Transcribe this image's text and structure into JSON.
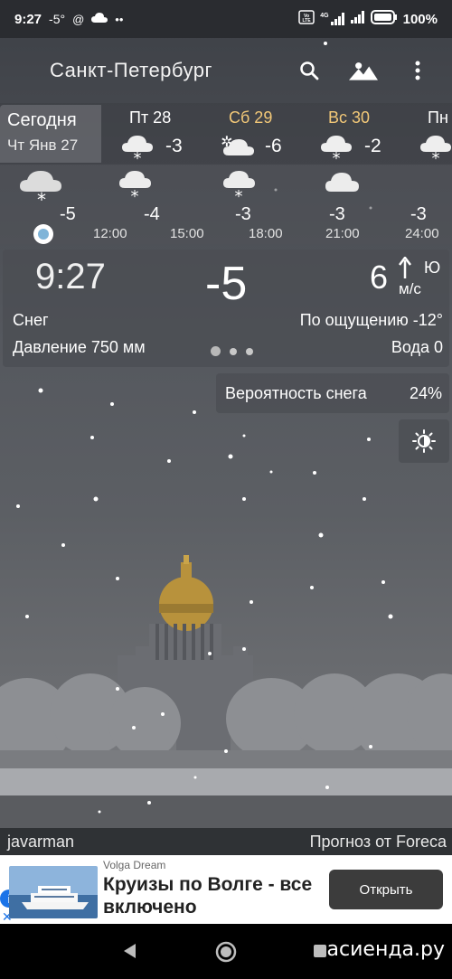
{
  "status_bar": {
    "time": "9:27",
    "temp": "-5°",
    "battery": "100%",
    "network": "4G"
  },
  "toolbar": {
    "city": "Санкт-Петербург"
  },
  "today": {
    "label": "Сегодня",
    "date": "Чт Янв 27"
  },
  "days": [
    {
      "name": "Пт 28",
      "temp": "-3",
      "weekend": false,
      "icon": "snow-cloud-icon"
    },
    {
      "name": "Сб 29",
      "temp": "-6",
      "weekend": true,
      "icon": "sun-snow-cloud-icon"
    },
    {
      "name": "Вс 30",
      "temp": "-2",
      "weekend": true,
      "icon": "snow-cloud-icon"
    },
    {
      "name": "Пн",
      "temp": "",
      "weekend": false,
      "icon": "snow-cloud-icon"
    }
  ],
  "hours": [
    {
      "temp": "-5",
      "time": "",
      "icon": "snow-cloud-icon"
    },
    {
      "temp": "-4",
      "time": "12:00",
      "icon": "snow-cloud-icon"
    },
    {
      "temp": "-3",
      "time": "15:00",
      "icon": "snow-cloud-icon"
    },
    {
      "temp": "-3",
      "time": "18:00",
      "icon": "cloud-icon"
    },
    {
      "temp": "-3",
      "time": "21:00",
      "icon": "none"
    },
    {
      "temp": "",
      "time": "24:00",
      "icon": "none"
    }
  ],
  "current": {
    "time": "9:27",
    "temp": "-5",
    "wind_speed": "6",
    "wind_dir": "Ю",
    "wind_unit": "м/с",
    "condition": "Снег",
    "feels_like": "По ощущению -12°",
    "pressure": "Давление 750 мм",
    "water": "Вода 0"
  },
  "snow_chance": {
    "label": "Вероятность снега",
    "value": "24%"
  },
  "credits": {
    "author": "javarman",
    "provider": "Прогноз от Foreca"
  },
  "ad": {
    "brand": "Volga Dream",
    "title": "Круизы по Волге - все включено",
    "button": "Открыть"
  },
  "watermark": "асиенда.ру",
  "colors": {
    "weekend": "#f2c878",
    "ad_button": "#3c3c3c",
    "ad_info": "#1a73e8"
  }
}
